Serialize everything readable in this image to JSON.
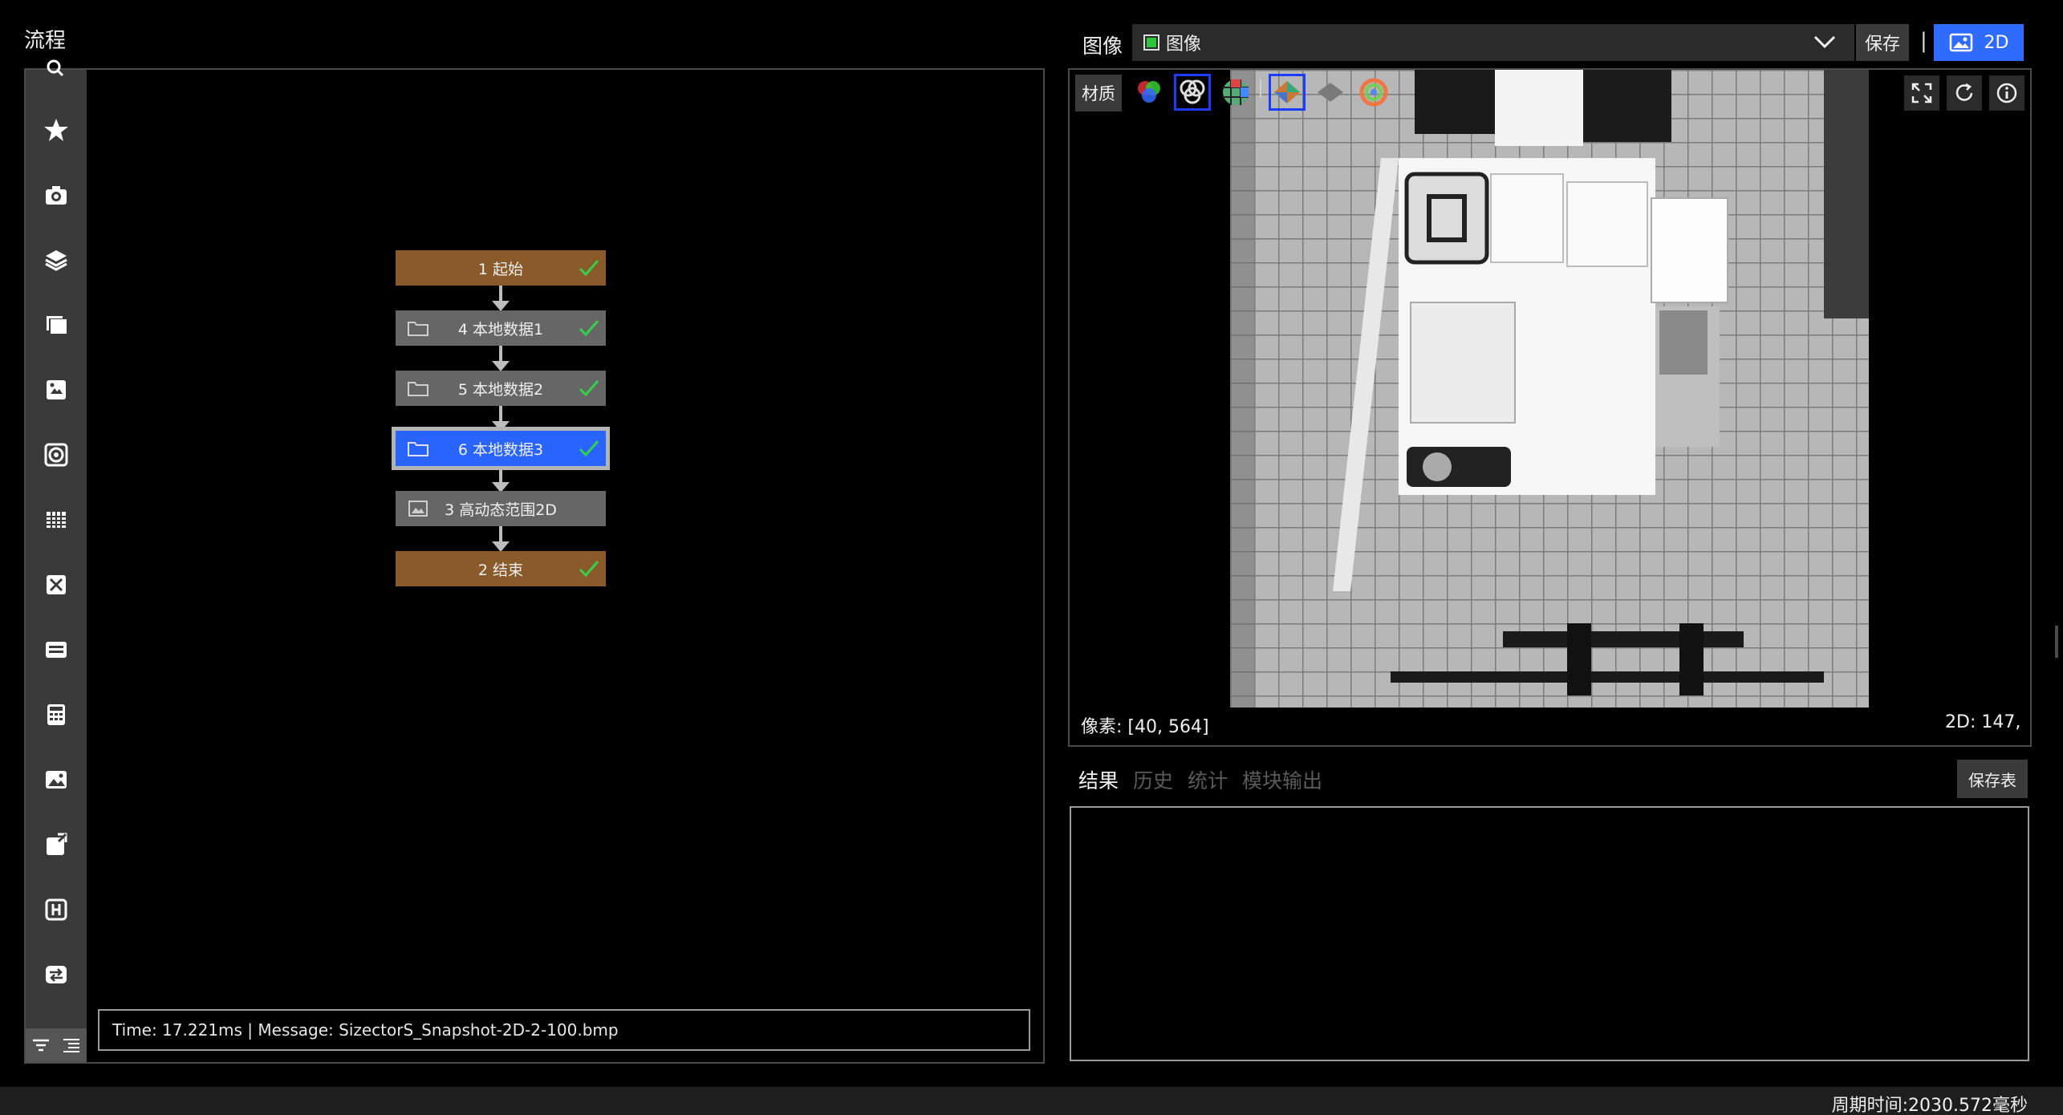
{
  "flow": {
    "title": "流程",
    "nodes": [
      {
        "label": "1 起始",
        "kind": "start",
        "done": true
      },
      {
        "label": "4 本地数据1",
        "kind": "folder",
        "done": true
      },
      {
        "label": "5 本地数据2",
        "kind": "folder",
        "done": true
      },
      {
        "label": "6 本地数据3",
        "kind": "folder",
        "done": true,
        "selected": true
      },
      {
        "label": "3 高动态范围2D",
        "kind": "image",
        "done": false
      },
      {
        "label": "2 结束",
        "kind": "start",
        "done": true
      }
    ],
    "status": "Time: 17.221ms  |   Message: SizectorS_Snapshot-2D-2-100.bmp",
    "toolbar_icons": [
      "search-icon",
      "star-icon",
      "camera-icon",
      "layers-icon",
      "frames-icon",
      "image-edit-icon",
      "target-icon",
      "grid-icon",
      "crop-icon",
      "keyboard-icon",
      "calculator-icon",
      "picture-icon",
      "export-icon",
      "bracket-icon",
      "transfer-icon"
    ]
  },
  "image_panel": {
    "label": "图像",
    "select_value": "图像",
    "save_label": "保存",
    "separator": "|",
    "mode_label": "2D",
    "material_label": "材质",
    "pixel_readout": "像素: [40, 564]",
    "value_readout": "2D: 147,"
  },
  "results": {
    "tabs": [
      "结果",
      "历史",
      "统计",
      "模块输出"
    ],
    "active_tab": 0,
    "save_table_label": "保存表"
  },
  "footer": {
    "cycle_time": "周期时间:2030.572毫秒"
  },
  "colors": {
    "accent": "#2f6bff",
    "start_node": "#8a5a2a",
    "local_node": "#666666",
    "check": "#35d04a"
  }
}
